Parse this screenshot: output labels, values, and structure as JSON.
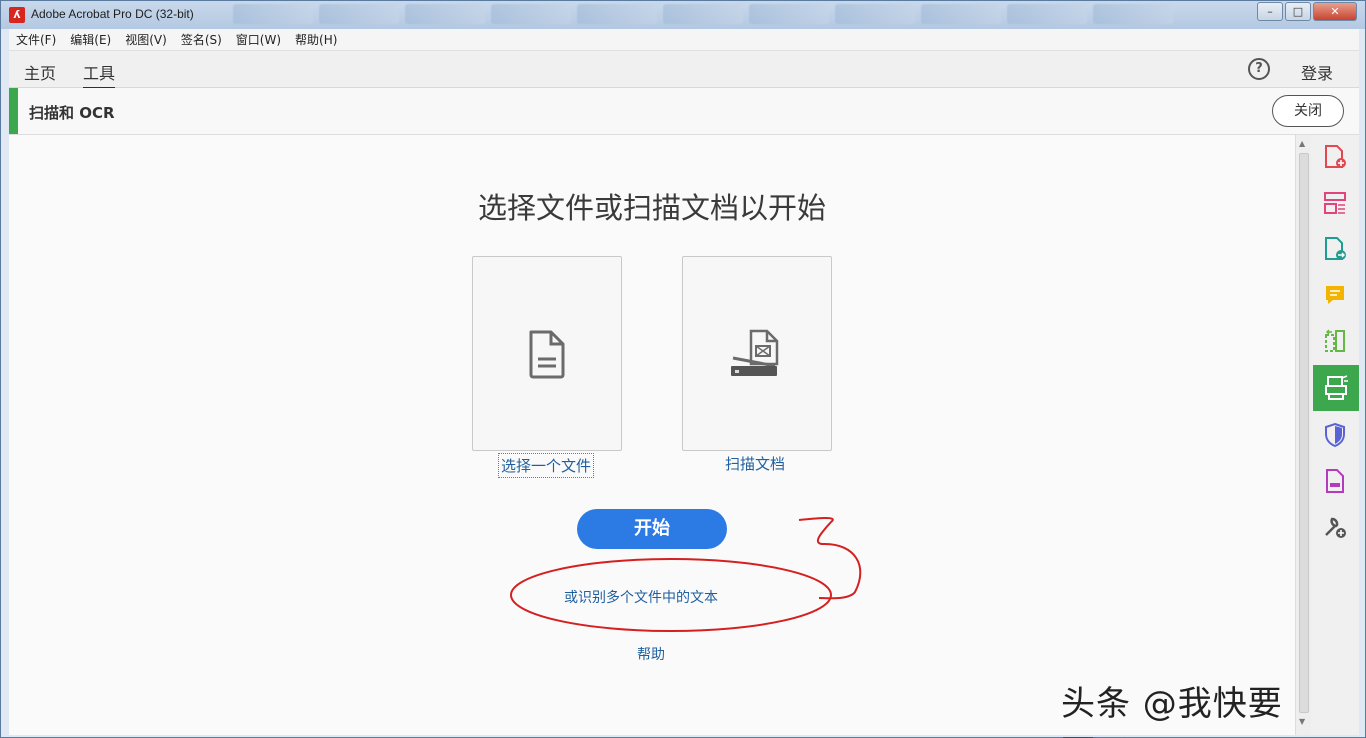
{
  "window": {
    "title": "Adobe Acrobat Pro DC (32-bit)"
  },
  "menu": [
    "文件(F)",
    "编辑(E)",
    "视图(V)",
    "签名(S)",
    "窗口(W)",
    "帮助(H)"
  ],
  "nav": {
    "home": "主页",
    "tools": "工具",
    "help_glyph": "?",
    "login": "登录"
  },
  "tool_header": {
    "title": "扫描和 OCR",
    "close": "关闭"
  },
  "main": {
    "heading": "选择文件或扫描文档以开始",
    "select_file": "选择一个文件",
    "scan_document": "扫描文档",
    "start": "开始",
    "multi_files": "或识别多个文件中的文本",
    "help": "帮助"
  },
  "watermark": "头条 @我快要死了",
  "rail_icons": [
    "create-pdf-icon",
    "organize-pages-icon",
    "export-pdf-icon",
    "comment-icon",
    "compare-icon",
    "scan-ocr-icon",
    "protect-icon",
    "fill-sign-icon",
    "more-tools-icon"
  ],
  "colors": {
    "accent_green": "#3da74e",
    "primary_blue": "#2c7be5",
    "link_blue": "#1f5f9f"
  }
}
